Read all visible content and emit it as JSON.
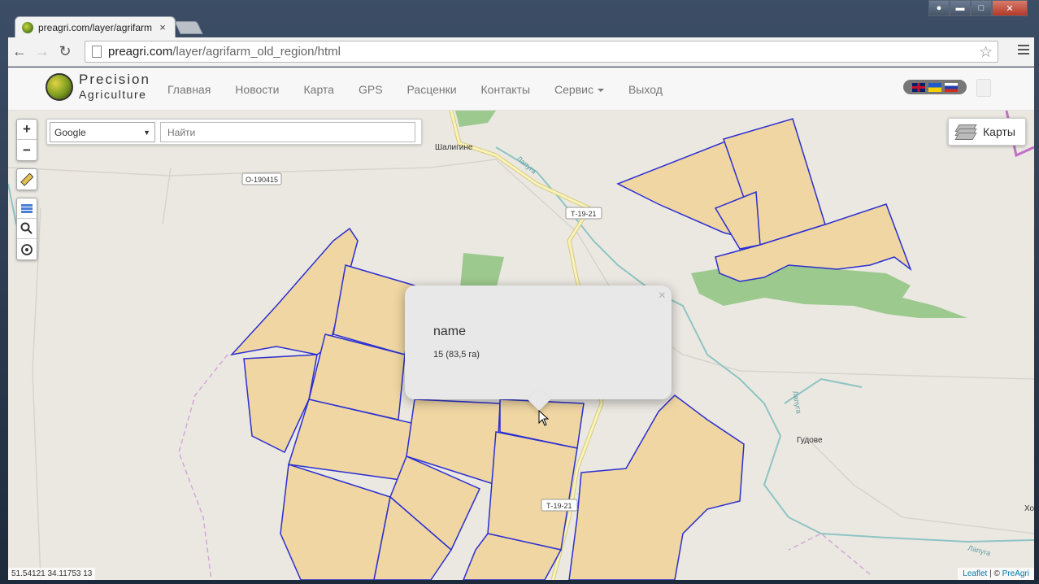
{
  "browser": {
    "tab_title": "preagri.com/layer/agrifarm",
    "tab_close": "×",
    "url_host": "preagri.com",
    "url_path": "/layer/agrifarm_old_region/html",
    "back_icon": "arrow-left-icon",
    "forward_icon": "arrow-right-icon",
    "reload_icon": "reload-icon",
    "bookmark_icon": "star-icon",
    "menu_icon": "hamburger-icon"
  },
  "site": {
    "logo_line1": "Precision",
    "logo_line2": "Agriculture",
    "nav": [
      "Главная",
      "Новости",
      "Карта",
      "GPS",
      "Расценки",
      "Контакты",
      "Сервис",
      "Выход"
    ],
    "languages": [
      "en",
      "ua",
      "ru"
    ]
  },
  "map": {
    "zoom_in": "+",
    "zoom_out": "−",
    "tools": [
      "ruler-icon",
      "layers-stack-icon",
      "search-icon",
      "locate-icon"
    ],
    "provider": "Google",
    "search_placeholder": "Найти",
    "layers_label": "Карты",
    "labels": {
      "village1": "Шалигине",
      "village2": "Гудове",
      "village3": "Хо",
      "road1": "О-190415",
      "road2": "Т-19-21",
      "road3": "Т-19-21",
      "river1": "Лапуга",
      "river2": "Лапуга",
      "river3": "Лапуга"
    },
    "popup": {
      "close": "×",
      "name": "name",
      "value": "15 (83,5 га)"
    },
    "coordinates": "51.54121 34.11753 13",
    "attribution_leaflet": "Leaflet",
    "attribution_sep": " | © ",
    "attribution_owner": "PreAgri",
    "colors": {
      "field_fill": "#efd6a3",
      "field_border": "#2b2fd0",
      "forest": "#9cc98e",
      "water": "#8fc4c4",
      "road": "#f5f0a8"
    }
  }
}
